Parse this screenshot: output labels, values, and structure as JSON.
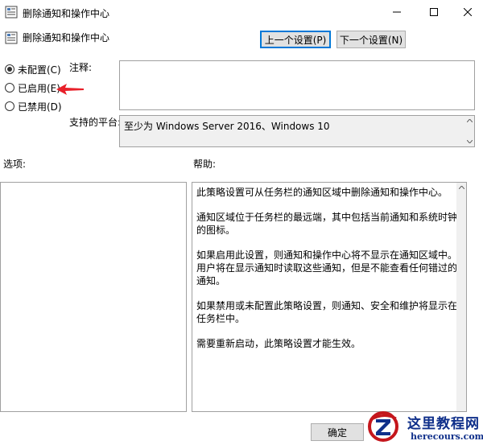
{
  "window": {
    "title": "删除通知和操作中心",
    "icon": "policy-icon",
    "controls": [
      "minimize-icon",
      "maximize-icon",
      "close-icon"
    ]
  },
  "header": {
    "policy_name": "删除通知和操作中心",
    "prev_label": "上一个设置(P)",
    "next_label": "下一个设置(N)"
  },
  "state": {
    "options": [
      {
        "label": "未配置(C)",
        "checked": true
      },
      {
        "label": "已启用(E)",
        "checked": false
      },
      {
        "label": "已禁用(D)",
        "checked": false
      }
    ]
  },
  "comment": {
    "label": "注释:",
    "value": ""
  },
  "platform": {
    "label": "支持的平台:",
    "value": "至少为 Windows Server 2016、Windows 10"
  },
  "options_panel": {
    "label": "选项:"
  },
  "help_panel": {
    "label": "帮助:",
    "paragraphs": [
      "此策略设置可从任务栏的通知区域中删除通知和操作中心。",
      "通知区域位于任务栏的最远端，其中包括当前通知和系统时钟的图标。",
      "如果启用此设置，则通知和操作中心将不显示在通知区域中。用户将在显示通知时读取这些通知，但是不能查看任何错过的通知。",
      "如果禁用或未配置此策略设置，则通知、安全和维护将显示在任务栏中。",
      "需要重新启动，此策略设置才能生效。"
    ]
  },
  "footer": {
    "ok_label": "确定"
  },
  "watermark": {
    "title": "这里教程网",
    "url": "herecours.com"
  },
  "colors": {
    "annotation_arrow": "#e8202a",
    "focus_border": "#0078d7",
    "watermark_text": "#0f2f8a",
    "watermark_logo": "#c4161c"
  }
}
